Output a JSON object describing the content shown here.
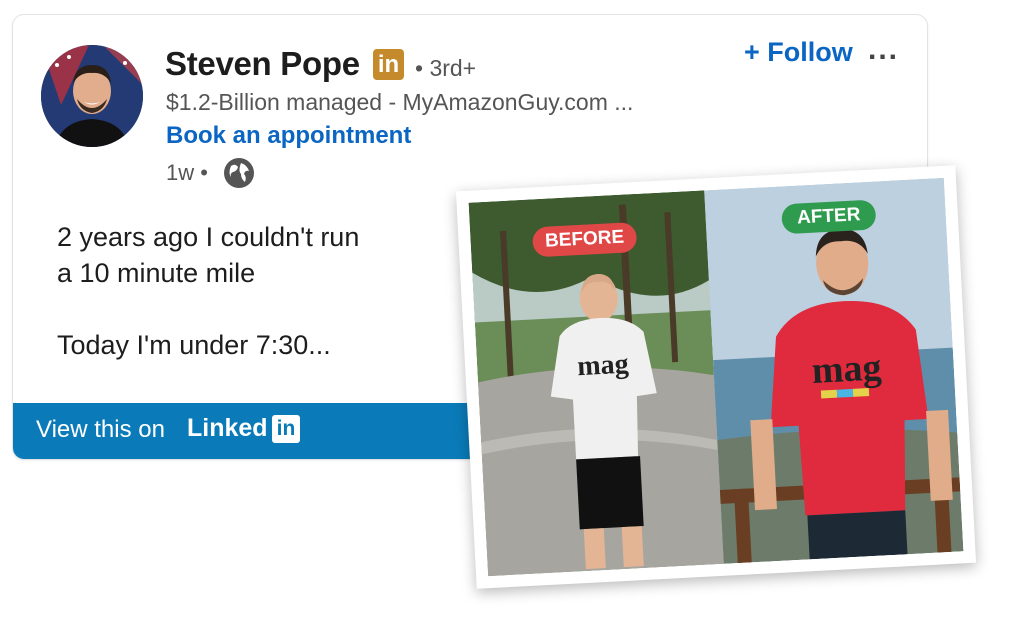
{
  "post": {
    "author_name": "Steven Pope",
    "linkedin_badge": "in",
    "connection_degree": "• 3rd+",
    "headline": "$1.2-Billion managed - MyAmazonGuy.com ...",
    "cta_link": "Book an appointment",
    "timestamp": "1w •",
    "visibility_icon": "globe-icon",
    "follow_label": "+ Follow",
    "more_label": "...",
    "body_lines": [
      "2 years ago I couldn't run",
      "a 10 minute mile",
      "Today I'm under 7:30..."
    ]
  },
  "footer": {
    "view_text": "View this on",
    "brand_word": "Linked",
    "brand_box": "in"
  },
  "photo": {
    "before_label": "BEFORE",
    "after_label": "AFTER",
    "shirt_text": "mag"
  },
  "colors": {
    "link_blue": "#0a66c2",
    "bar_blue": "#0a7bb8",
    "premium_gold": "#c48a2c",
    "before_red": "#e04848",
    "after_green": "#2e9b4e"
  }
}
